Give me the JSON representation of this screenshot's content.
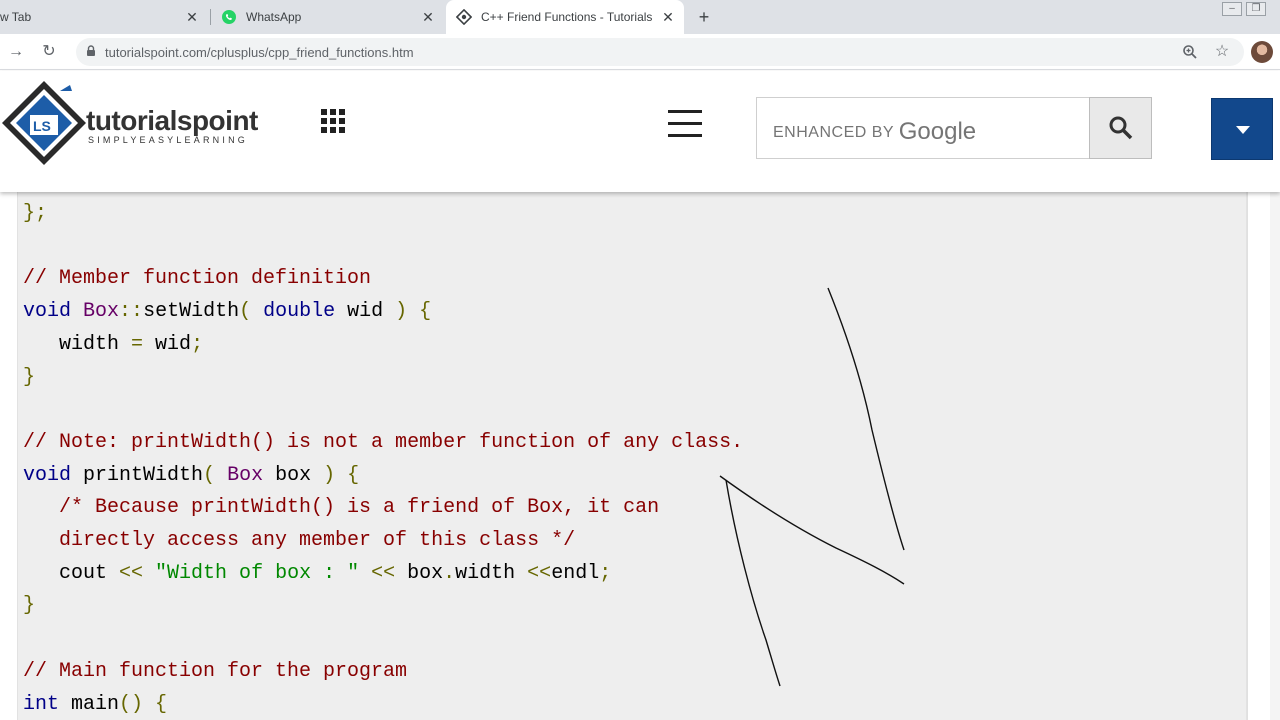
{
  "browser": {
    "tabs": [
      {
        "title": "w Tab",
        "active": false
      },
      {
        "title": "WhatsApp",
        "active": false
      },
      {
        "title": "C++ Friend Functions - Tutorials",
        "active": true
      }
    ],
    "new_tab_label": "+",
    "url": "tutorialspoint.com/cplusplus/cpp_friend_functions.htm"
  },
  "header": {
    "logo_text": "tutorialspoint",
    "logo_tagline": "SIMPLYEASYLEARNING",
    "search_placeholder_prefix": "ENHANCED BY",
    "search_placeholder_brand": "Google"
  },
  "colors": {
    "dropdown_button": "#12488c",
    "code_background": "#eeeeee",
    "comment": "#880000",
    "keyword": "#000088",
    "string": "#008800"
  },
  "code": {
    "lines": [
      [
        {
          "t": "};",
          "c": "pun"
        }
      ],
      [],
      [
        {
          "t": "// Member function definition",
          "c": "com"
        }
      ],
      [
        {
          "t": "void",
          "c": "kw"
        },
        {
          "t": " ",
          "c": "pln"
        },
        {
          "t": "Box",
          "c": "typ"
        },
        {
          "t": "::",
          "c": "pun"
        },
        {
          "t": "setWidth",
          "c": "pln"
        },
        {
          "t": "( ",
          "c": "pun"
        },
        {
          "t": "double",
          "c": "kw"
        },
        {
          "t": " wid ",
          "c": "pln"
        },
        {
          "t": ") {",
          "c": "pun"
        }
      ],
      [
        {
          "t": "   width ",
          "c": "pln"
        },
        {
          "t": "=",
          "c": "pun"
        },
        {
          "t": " wid",
          "c": "pln"
        },
        {
          "t": ";",
          "c": "pun"
        }
      ],
      [
        {
          "t": "}",
          "c": "pun"
        }
      ],
      [],
      [
        {
          "t": "// Note: printWidth() is not a member function of any class.",
          "c": "com"
        }
      ],
      [
        {
          "t": "void",
          "c": "kw"
        },
        {
          "t": " printWidth",
          "c": "pln"
        },
        {
          "t": "( ",
          "c": "pun"
        },
        {
          "t": "Box",
          "c": "typ"
        },
        {
          "t": " box ",
          "c": "pln"
        },
        {
          "t": ") {",
          "c": "pun"
        }
      ],
      [
        {
          "t": "   /* Because printWidth() is a friend of Box, it can",
          "c": "com"
        }
      ],
      [
        {
          "t": "   directly access any member of this class */",
          "c": "com"
        }
      ],
      [
        {
          "t": "   cout ",
          "c": "pln"
        },
        {
          "t": "<<",
          "c": "pun"
        },
        {
          "t": " ",
          "c": "pln"
        },
        {
          "t": "\"Width of box : \"",
          "c": "str"
        },
        {
          "t": " ",
          "c": "pln"
        },
        {
          "t": "<<",
          "c": "pun"
        },
        {
          "t": " box",
          "c": "pln"
        },
        {
          "t": ".",
          "c": "pun"
        },
        {
          "t": "width ",
          "c": "pln"
        },
        {
          "t": "<<",
          "c": "pun"
        },
        {
          "t": "endl",
          "c": "pln"
        },
        {
          "t": ";",
          "c": "pun"
        }
      ],
      [
        {
          "t": "}",
          "c": "pun"
        }
      ],
      [],
      [
        {
          "t": "// Main function for the program",
          "c": "com"
        }
      ],
      [
        {
          "t": "int",
          "c": "kw"
        },
        {
          "t": " main",
          "c": "pln"
        },
        {
          "t": "() {",
          "c": "pun"
        }
      ]
    ]
  },
  "icons": [
    "whatsapp-icon",
    "tutorialspoint-tab-icon",
    "lock-icon",
    "zoom-icon",
    "star-icon",
    "grid-icon",
    "hamburger-icon",
    "search-icon",
    "caret-down-icon"
  ]
}
